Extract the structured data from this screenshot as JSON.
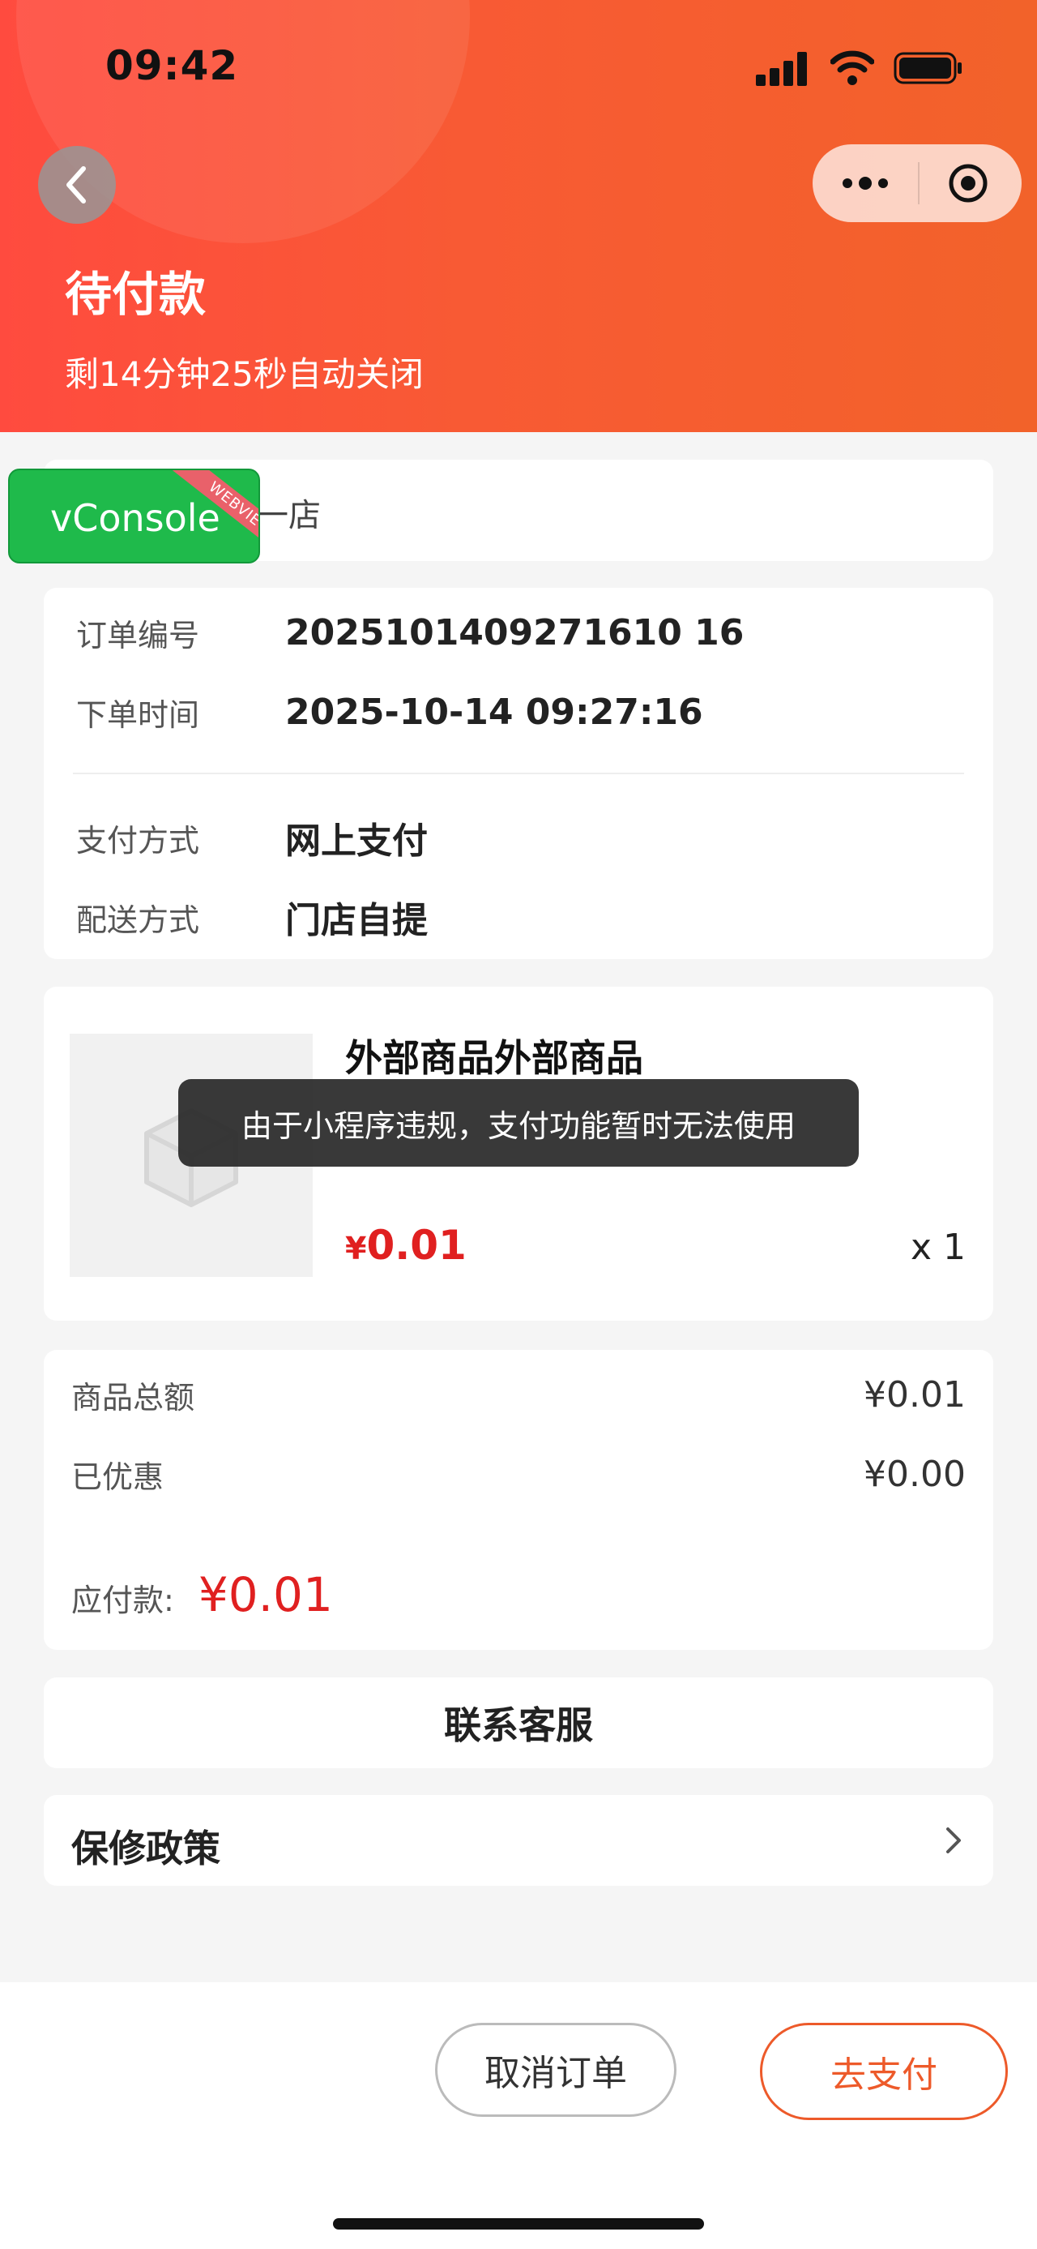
{
  "status_bar": {
    "time": "09:42"
  },
  "header": {
    "title": "待付款",
    "countdown": "剩14分钟25秒自动关闭"
  },
  "vconsole": {
    "label": "vConsole",
    "ribbon": "WEBVIEW"
  },
  "store": {
    "name": "一店"
  },
  "order_info": {
    "rows": [
      {
        "key": "订单编号",
        "value": "2025101409271610 16"
      },
      {
        "key": "下单时间",
        "value": "2025-10-14 09:27:16"
      },
      {
        "key": "支付方式",
        "value": "网上支付"
      },
      {
        "key": "配送方式",
        "value": "门店自提"
      }
    ]
  },
  "goods": {
    "name": "外部商品外部商品",
    "price_symbol": "¥",
    "price": "0.01",
    "quantity": "x 1"
  },
  "toast": {
    "message": "由于小程序违规，支付功能暂时无法使用"
  },
  "amounts": {
    "total_label": "商品总额",
    "total_value": "¥0.01",
    "discount_label": "已优惠",
    "discount_value": "¥0.00",
    "payable_label": "应付款:",
    "payable_value": "¥0.01"
  },
  "service": {
    "label": "联系客服"
  },
  "policy": {
    "label": "保修政策"
  },
  "actions": {
    "cancel_label": "取消订单",
    "pay_label": "去支付"
  },
  "colors": {
    "header_start": "#ff4b3f",
    "header_end": "#f2622a",
    "price_red": "#e02020",
    "pay_orange": "#ed5a2a",
    "vconsole_green": "#1fba4b"
  }
}
